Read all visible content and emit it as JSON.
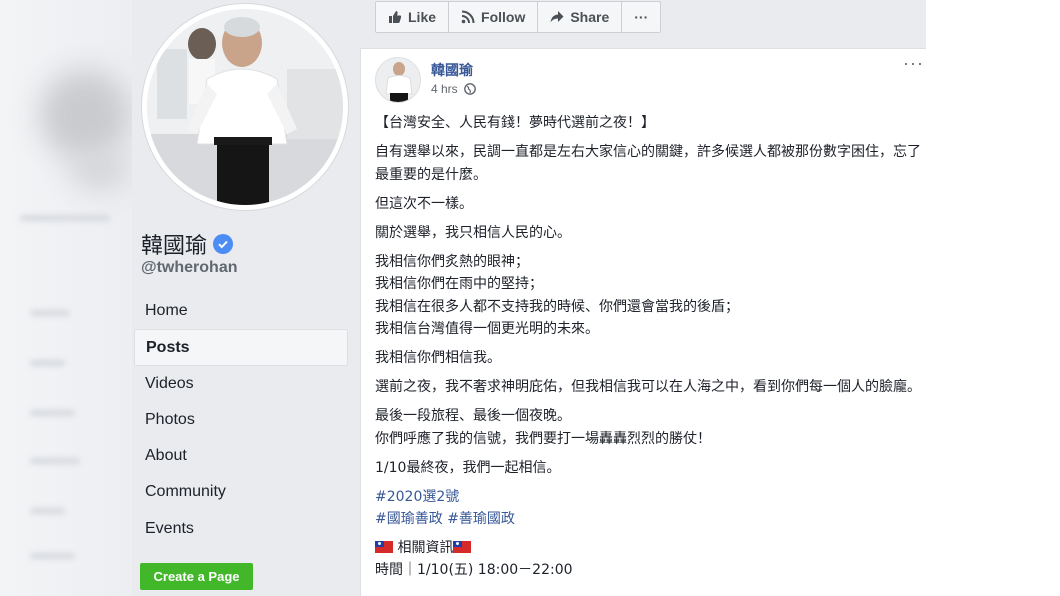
{
  "left": {
    "page_name": "韓國瑜",
    "handle": "@twherohan",
    "nav": [
      "Home",
      "Posts",
      "Videos",
      "Photos",
      "About",
      "Community",
      "Events"
    ],
    "active_nav": "Posts",
    "create_page_label": "Create a Page",
    "verified_icon": "verified-badge-icon"
  },
  "action_bar": {
    "like_label": "Like",
    "follow_label": "Follow",
    "share_label": "Share",
    "more_label": "···"
  },
  "post": {
    "author": "韓國瑜",
    "time": "4 hrs",
    "title_line": "【台灣安全、人民有錢！夢時代選前之夜！】",
    "para1": "自有選舉以來，民調一直都是左右大家信心的關鍵，許多候選人都被那份數字困住，忘了最重要的是什麼。",
    "para2": "但這次不一樣。",
    "para3": "關於選舉，我只相信人民的心。",
    "para4_lines": [
      "我相信你們炙熱的眼神；",
      "我相信你們在雨中的堅持；",
      "我相信在很多人都不支持我的時候、你們還會當我的後盾；",
      "我相信台灣值得一個更光明的未來。"
    ],
    "para5": "我相信你們相信我。",
    "para6": "選前之夜，我不奢求神明庇佑，但我相信我可以在人海之中，看到你們每一個人的臉龐。",
    "para7_lines": [
      "最後一段旅程、最後一個夜晚。",
      "你們呼應了我的信號，我們要打一場轟轟烈烈的勝仗！"
    ],
    "para8": "1/10最終夜，我們一起相信。",
    "hashtag1": "#2020選2號",
    "hashtag2": "#國瑜善政",
    "hashtag3": "#善瑜國政",
    "info_label": " 相關資訊",
    "time_row": "時間｜1/10(五) 18:00－22:00"
  }
}
